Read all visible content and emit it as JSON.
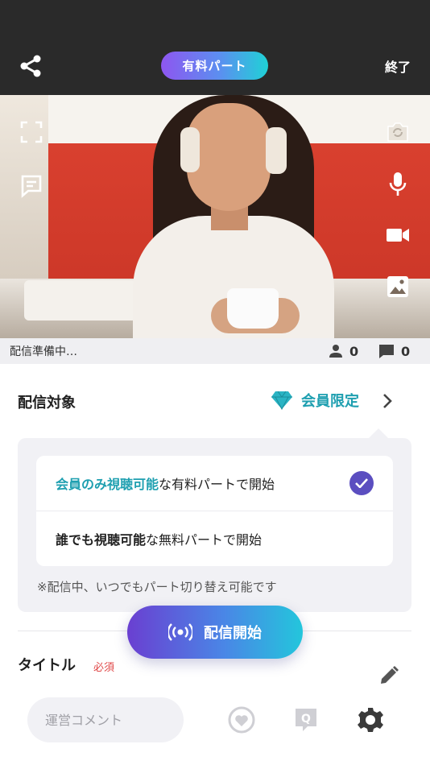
{
  "header": {
    "share_icon": "share-icon",
    "part_badge": "有料パート",
    "end_label": "終了"
  },
  "video_overlay": {
    "left_icons": [
      "fullscreen-icon",
      "comment-bubble-icon"
    ],
    "right_icons": [
      "camera-flip-icon",
      "microphone-icon",
      "video-camera-icon",
      "image-icon"
    ]
  },
  "status": {
    "text": "配信準備中…",
    "viewers": "0",
    "comments": "0"
  },
  "target": {
    "label": "配信対象",
    "value": "会員限定",
    "value_icon": "diamond-icon",
    "accent_color": "#1e9fb0"
  },
  "options": [
    {
      "highlight": "会員のみ視聴可能",
      "rest": "な有料パートで開始",
      "selected": true
    },
    {
      "highlight": "誰でも視聴可能",
      "rest": "な無料パートで開始",
      "selected": false
    }
  ],
  "options_note": "※配信中、いつでもパート切り替え可能です",
  "start_button": {
    "label": "配信開始",
    "icon": "broadcast-icon"
  },
  "title_section": {
    "label": "タイトル",
    "required": "必須"
  },
  "bottom": {
    "comment_placeholder": "運営コメント",
    "icons": [
      "heart-badge-icon",
      "question-icon",
      "settings-icon"
    ]
  },
  "colors": {
    "check": "#5b4ec0",
    "required": "#e04848",
    "header_bg": "#2a2a2a"
  }
}
